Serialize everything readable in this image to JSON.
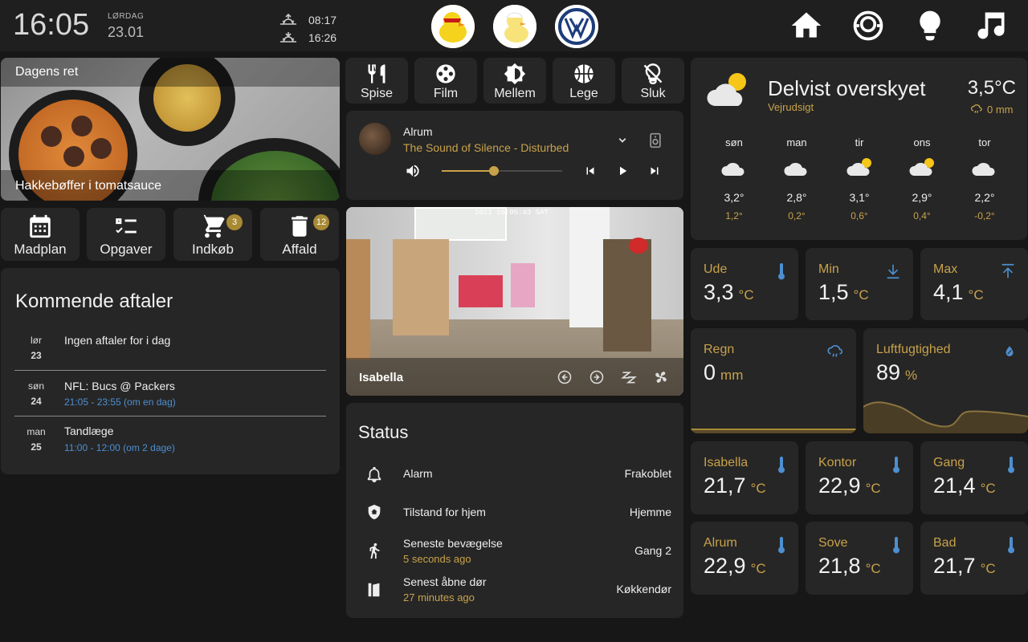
{
  "header": {
    "time": "16:05",
    "weekday": "LØRDAG",
    "date": "23.01",
    "sunrise": "08:17",
    "sunset": "16:26"
  },
  "food": {
    "label": "Dagens ret",
    "dish": "Hakkebøffer i tomatsauce"
  },
  "quick_buttons": [
    {
      "label": "Madplan",
      "icon": "calendar-icon"
    },
    {
      "label": "Opgaver",
      "icon": "checklist-icon"
    },
    {
      "label": "Indkøb",
      "icon": "cart-icon",
      "badge": "3"
    },
    {
      "label": "Affald",
      "icon": "trash-icon",
      "badge": "12"
    }
  ],
  "agenda": {
    "title": "Kommende aftaler",
    "items": [
      {
        "day": "lør",
        "num": "23",
        "title": "Ingen aftaler for i dag",
        "time": ""
      },
      {
        "day": "søn",
        "num": "24",
        "title": "NFL: Bucs @ Packers",
        "time": "21:05 - 23:55 (om en dag)"
      },
      {
        "day": "man",
        "num": "25",
        "title": "Tandlæge",
        "time": "11:00 - 12:00 (om 2 dage)"
      }
    ]
  },
  "scenes": [
    {
      "label": "Spise",
      "icon": "cutlery-icon"
    },
    {
      "label": "Film",
      "icon": "film-icon"
    },
    {
      "label": "Mellem",
      "icon": "brightness-icon"
    },
    {
      "label": "Lege",
      "icon": "ball-icon"
    },
    {
      "label": "Sluk",
      "icon": "lightbulb-off-icon"
    }
  ],
  "media": {
    "room": "Alrum",
    "track": "The Sound of Silence - Disturbed",
    "volume": 0.43
  },
  "camera": {
    "name": "Isabella",
    "timestamp": "2021 16:05:43 SAT"
  },
  "status": {
    "title": "Status",
    "rows": [
      {
        "label": "Alarm",
        "sub": "",
        "value": "Frakoblet",
        "icon": "bell-icon"
      },
      {
        "label": "Tilstand for hjem",
        "sub": "",
        "value": "Hjemme",
        "icon": "home-shield-icon"
      },
      {
        "label": "Seneste bevægelse",
        "sub": "5 seconds ago",
        "value": "Gang 2",
        "icon": "walk-icon"
      },
      {
        "label": "Senest åbne dør",
        "sub": "27 minutes ago",
        "value": "Køkkendør",
        "icon": "door-icon"
      }
    ]
  },
  "weather": {
    "condition": "Delvist overskyet",
    "source": "Vejrudsigt",
    "temp": "3,5°C",
    "precip": "0 mm",
    "forecast": [
      {
        "day": "søn",
        "hi": "3,2°",
        "lo": "1,2°",
        "sun": false
      },
      {
        "day": "man",
        "hi": "2,8°",
        "lo": "0,2°",
        "sun": false
      },
      {
        "day": "tir",
        "hi": "3,1°",
        "lo": "0,6°",
        "sun": true
      },
      {
        "day": "ons",
        "hi": "2,9°",
        "lo": "0,4°",
        "sun": true
      },
      {
        "day": "tor",
        "hi": "2,2°",
        "lo": "-0,2°",
        "sun": false
      }
    ]
  },
  "sensors": {
    "ude": {
      "label": "Ude",
      "value": "3,3",
      "unit": "°C"
    },
    "min": {
      "label": "Min",
      "value": "1,5",
      "unit": "°C"
    },
    "max": {
      "label": "Max",
      "value": "4,1",
      "unit": "°C"
    },
    "regn": {
      "label": "Regn",
      "value": "0",
      "unit": "mm"
    },
    "fugt": {
      "label": "Luftfugtighed",
      "value": "89",
      "unit": "%"
    },
    "rooms": [
      {
        "label": "Isabella",
        "value": "21,7",
        "unit": "°C"
      },
      {
        "label": "Kontor",
        "value": "22,9",
        "unit": "°C"
      },
      {
        "label": "Gang",
        "value": "21,4",
        "unit": "°C"
      },
      {
        "label": "Alrum",
        "value": "22,9",
        "unit": "°C"
      },
      {
        "label": "Sove",
        "value": "21,8",
        "unit": "°C"
      },
      {
        "label": "Bad",
        "value": "21,7",
        "unit": "°C"
      }
    ]
  }
}
